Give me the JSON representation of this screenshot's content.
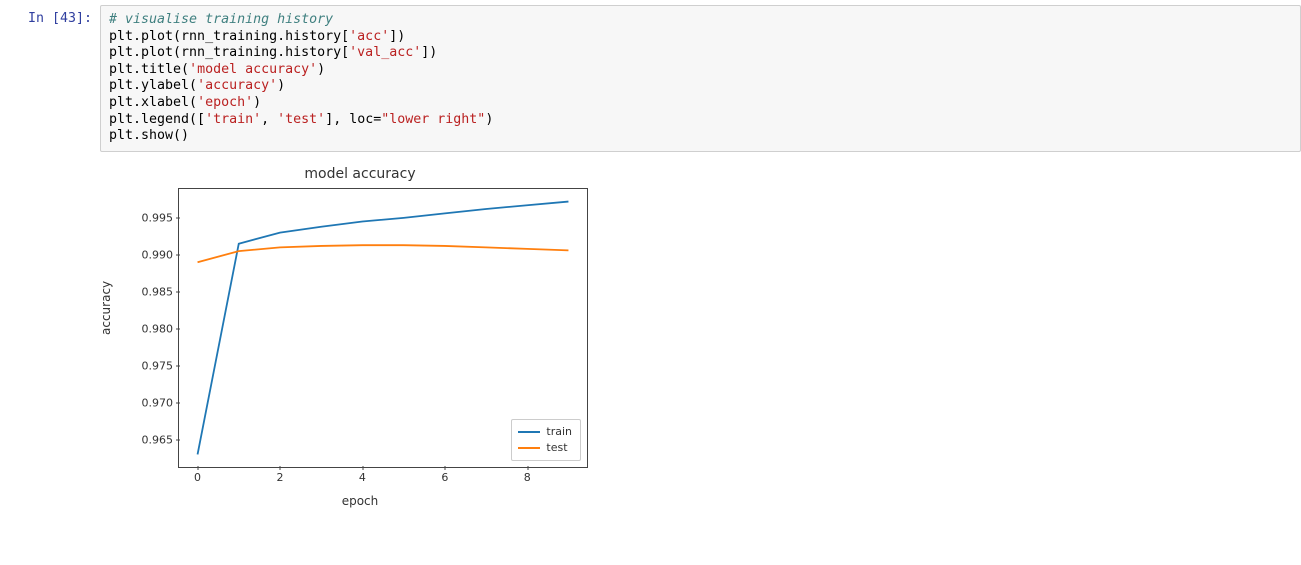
{
  "cell": {
    "prompt": "In [43]:",
    "code": {
      "comment": "# visualise training history",
      "l1a": "plt.plot(rnn_training.history[",
      "l1b": "'acc'",
      "l1c": "])",
      "l2a": "plt.plot(rnn_training.history[",
      "l2b": "'val_acc'",
      "l2c": "])",
      "l3a": "plt.title(",
      "l3b": "'model accuracy'",
      "l3c": ")",
      "l4a": "plt.ylabel(",
      "l4b": "'accuracy'",
      "l4c": ")",
      "l5a": "plt.xlabel(",
      "l5b": "'epoch'",
      "l5c": ")",
      "l6a": "plt.legend([",
      "l6b": "'train'",
      "l6c": ", ",
      "l6d": "'test'",
      "l6e": "], loc=",
      "l6f": "\"lower right\"",
      "l6g": ")",
      "l7": "plt.show()"
    }
  },
  "chart_data": {
    "type": "line",
    "title": "model accuracy",
    "xlabel": "epoch",
    "ylabel": "accuracy",
    "x": [
      0,
      1,
      2,
      3,
      4,
      5,
      6,
      7,
      8,
      9
    ],
    "series": [
      {
        "name": "train",
        "color": "#1f77b4",
        "values": [
          0.963,
          0.9915,
          0.993,
          0.9938,
          0.9945,
          0.995,
          0.9956,
          0.9962,
          0.9967,
          0.9972
        ]
      },
      {
        "name": "test",
        "color": "#ff7f0e",
        "values": [
          0.989,
          0.9905,
          0.991,
          0.9912,
          0.9913,
          0.9913,
          0.9912,
          0.991,
          0.9908,
          0.9906
        ]
      }
    ],
    "xlim": [
      -0.45,
      9.45
    ],
    "ylim": [
      0.9613,
      0.9989
    ],
    "xticks": [
      0,
      2,
      4,
      6,
      8
    ],
    "yticks": [
      0.965,
      0.97,
      0.975,
      0.98,
      0.985,
      0.99,
      0.995
    ],
    "legend_pos": "lower right"
  }
}
